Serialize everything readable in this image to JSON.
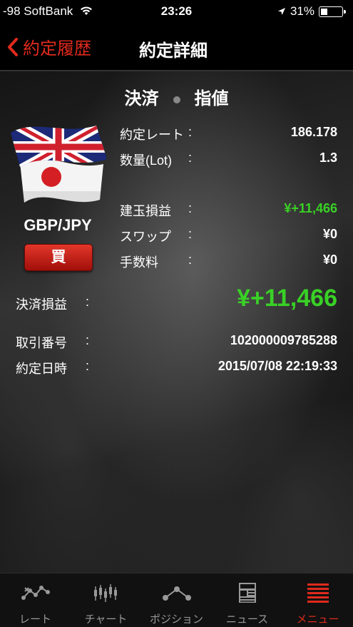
{
  "status_bar": {
    "carrier": "-98 SoftBank",
    "time": "23:26",
    "battery": "31%",
    "battery_level": 0.31
  },
  "nav": {
    "back_label": "約定履歴",
    "title": "約定詳細"
  },
  "header": {
    "type": "決済",
    "order_type": "指値"
  },
  "pair": {
    "symbol": "GBP/JPY",
    "side": "買"
  },
  "details": {
    "rate_label": "約定レート",
    "rate_value": "186.178",
    "lot_label": "数量(Lot)",
    "lot_value": "1.3",
    "position_pl_label": "建玉損益",
    "position_pl_value": "¥+11,466",
    "swap_label": "スワップ",
    "swap_value": "¥0",
    "fee_label": "手数料",
    "fee_value": "¥0",
    "settlement_pl_label": "決済損益",
    "settlement_pl_value": "¥+11,466",
    "trade_no_label": "取引番号",
    "trade_no_value": "102000009785288",
    "datetime_label": "約定日時",
    "datetime_value": "2015/07/08 22:19:33",
    "colon": ":"
  },
  "tabs": [
    {
      "label": "レート",
      "icon": "rate-icon"
    },
    {
      "label": "チャート",
      "icon": "chart-icon"
    },
    {
      "label": "ポジション",
      "icon": "position-icon"
    },
    {
      "label": "ニュース",
      "icon": "news-icon"
    },
    {
      "label": "メニュー",
      "icon": "menu-icon"
    }
  ],
  "colors": {
    "accent": "#e02a1c",
    "profit": "#39d126"
  }
}
